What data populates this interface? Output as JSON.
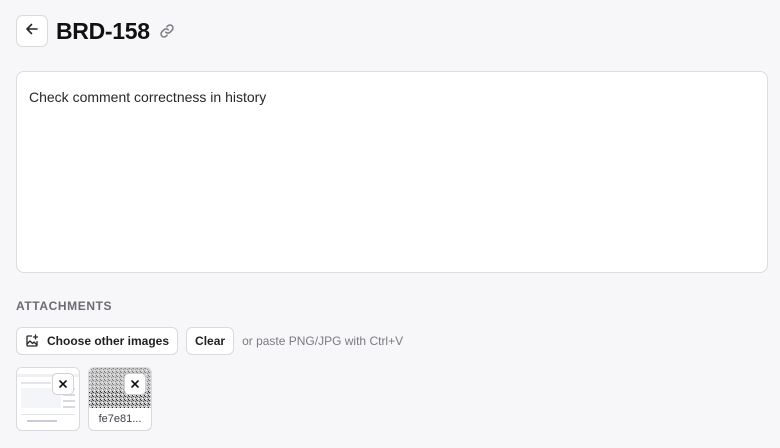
{
  "header": {
    "title": "BRD-158",
    "back_icon": "arrow-left-icon",
    "link_icon": "link-icon"
  },
  "editor": {
    "content": "Check comment correctness in history"
  },
  "attachments": {
    "section_label": "ATTACHMENTS",
    "choose_button_label": "Choose other images",
    "choose_button_icon": "image-plus-icon",
    "clear_button_label": "Clear",
    "hint_text": "or paste PNG/JPG with Ctrl+V",
    "items": [
      {
        "name": "",
        "remove_icon": "close-icon"
      },
      {
        "name": "fe7e81...",
        "remove_icon": "close-icon"
      }
    ]
  },
  "colors": {
    "page_background": "#f7f7f9",
    "surface": "#ffffff",
    "border": "#d9d9de",
    "muted_text": "#6b6b73"
  }
}
